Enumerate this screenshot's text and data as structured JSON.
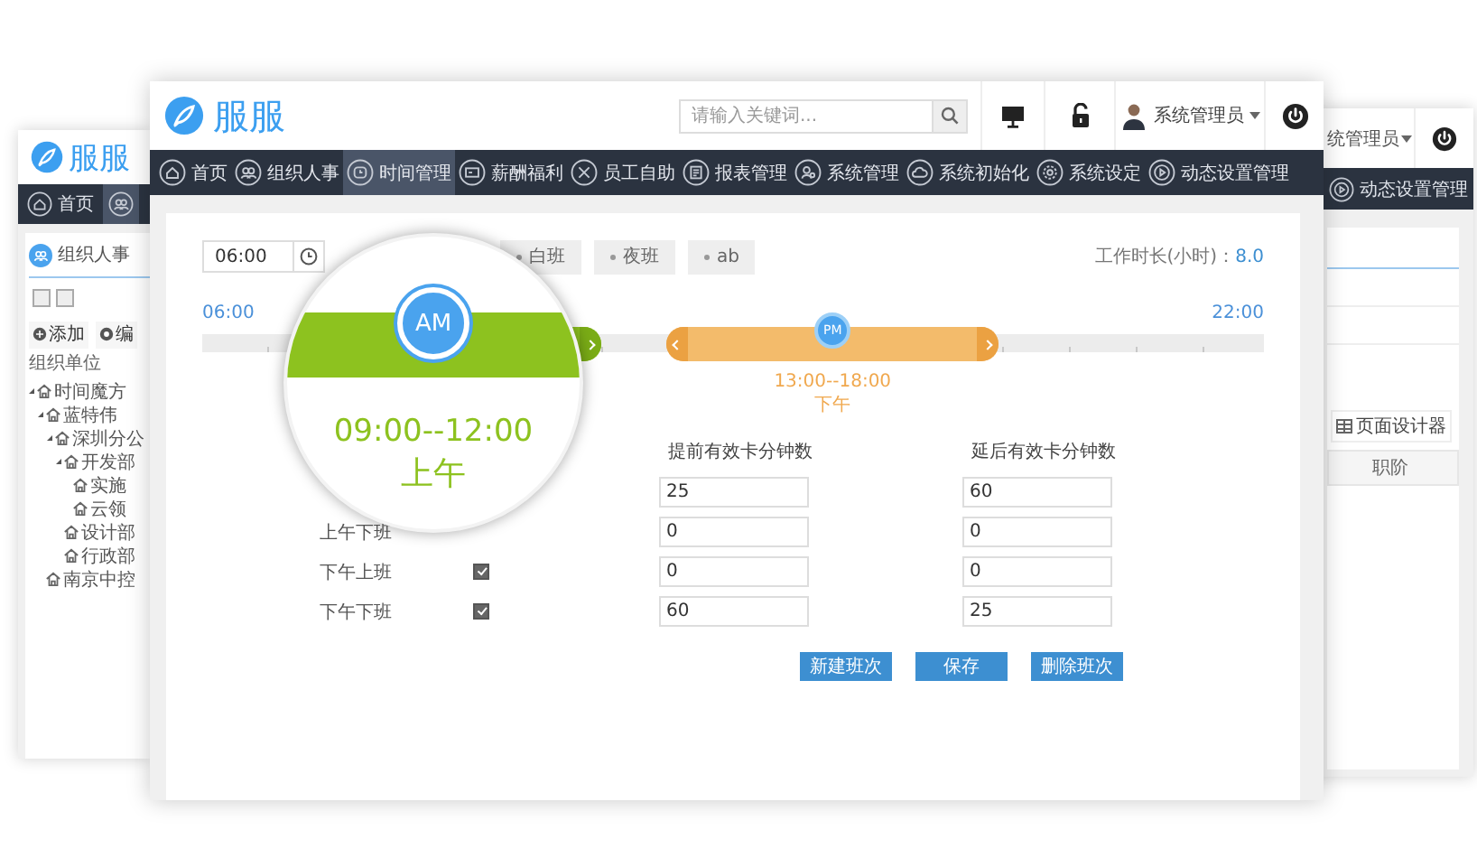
{
  "left_window": {
    "logo": "服服",
    "nav": [
      {
        "label": "首页"
      }
    ],
    "panel_title": "组织人事",
    "actions": [
      "添加",
      "编"
    ],
    "section": "组织单位",
    "tree": [
      {
        "label": "时间魔方",
        "expanded": true,
        "children": [
          {
            "label": "蓝特伟",
            "expanded": true,
            "children": [
              {
                "label": "深圳分公",
                "expanded": true,
                "children": [
                  {
                    "label": "开发部",
                    "expanded": true,
                    "children": [
                      {
                        "label": "实施"
                      },
                      {
                        "label": "云领"
                      }
                    ]
                  },
                  {
                    "label": "设计部"
                  },
                  {
                    "label": "行政部"
                  }
                ]
              }
            ]
          },
          {
            "label": "南京中控"
          }
        ]
      }
    ]
  },
  "front_window": {
    "logo": "服服",
    "search": {
      "placeholder": "请输入关键词..."
    },
    "user": "系统管理员",
    "nav": [
      {
        "label": "首页",
        "selected": false
      },
      {
        "label": "组织人事",
        "selected": false
      },
      {
        "label": "时间管理",
        "selected": true
      },
      {
        "label": "薪酬福利",
        "selected": false
      },
      {
        "label": "员工自助",
        "selected": false
      },
      {
        "label": "报表管理",
        "selected": false
      },
      {
        "label": "系统管理",
        "selected": false
      },
      {
        "label": "系统初始化",
        "selected": false
      },
      {
        "label": "系统设定",
        "selected": false
      },
      {
        "label": "动态设置管理",
        "selected": false
      }
    ],
    "time_field": {
      "value": "06:00"
    },
    "shift_tags": [
      "白班",
      "夜班",
      "ab"
    ],
    "work_hours": {
      "label": "工作时长(小时)：",
      "value": "8.0"
    },
    "timeline": {
      "start": "06:00",
      "end": "22:00",
      "segments": [
        {
          "kind": "am",
          "badge": "AM",
          "time": "09:00--12:00",
          "period": "上午"
        },
        {
          "kind": "pm",
          "badge": "PM",
          "time": "13:00--18:00",
          "period": "下午"
        }
      ]
    },
    "table": {
      "columns": [
        "提前有效卡分钟数",
        "延后有效卡分钟数"
      ],
      "rows": [
        {
          "before": "25",
          "after": "60"
        },
        {
          "label": "上午下班",
          "before": "0",
          "after": "0"
        },
        {
          "label": "下午上班",
          "checked": true,
          "before": "0",
          "after": "0"
        },
        {
          "label": "下午下班",
          "checked": true,
          "before": "60",
          "after": "25"
        }
      ]
    },
    "buttons": [
      "新建班次",
      "保存",
      "删除班次"
    ]
  },
  "right_window": {
    "user": "统管理员",
    "nav": [
      {
        "label": "动态设置管理"
      }
    ],
    "toolbar_button": "页面设计器",
    "column": "职阶"
  }
}
